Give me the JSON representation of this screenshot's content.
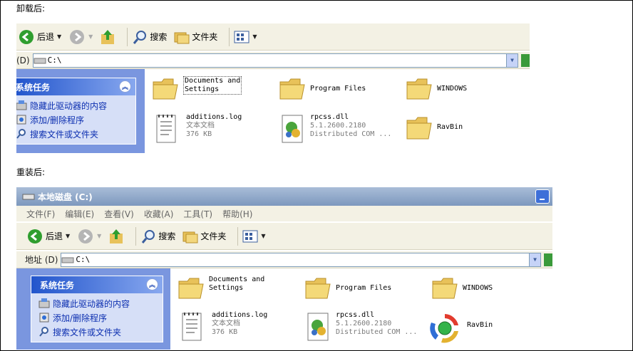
{
  "captions": {
    "before": "卸载后:",
    "after": "重装后:"
  },
  "toolbar": {
    "back": "后退",
    "search": "搜索",
    "folders": "文件夹"
  },
  "address": {
    "label": "地址 (D)",
    "label_short": "(D)",
    "path": "C:\\"
  },
  "window2": {
    "title": "本地磁盘 (C:)",
    "menu": [
      "文件(F)",
      "编辑(E)",
      "查看(V)",
      "收藏(A)",
      "工具(T)",
      "帮助(H)"
    ]
  },
  "taskpane": {
    "title": "系统任务",
    "links": [
      "隐藏此驱动器的内容",
      "添加/删除程序",
      "搜索文件或文件夹"
    ]
  },
  "files": {
    "documents": {
      "name1": "Documents and",
      "name2": "Settings"
    },
    "program_files": {
      "name": "Program Files"
    },
    "windows": {
      "name": "WINDOWS"
    },
    "additions": {
      "name": "additions.log",
      "type": "文本文档",
      "size": "376 KB"
    },
    "rpcss": {
      "name": "rpcss.dll",
      "version": "5.1.2600.2180",
      "desc": "Distributed COM ..."
    },
    "ravbin": {
      "name": "RavBin"
    }
  },
  "colors": {
    "taskpane_bg": "#7a96df",
    "toolbar_bg": "#f3f1e4",
    "link": "#0c2fb0"
  }
}
